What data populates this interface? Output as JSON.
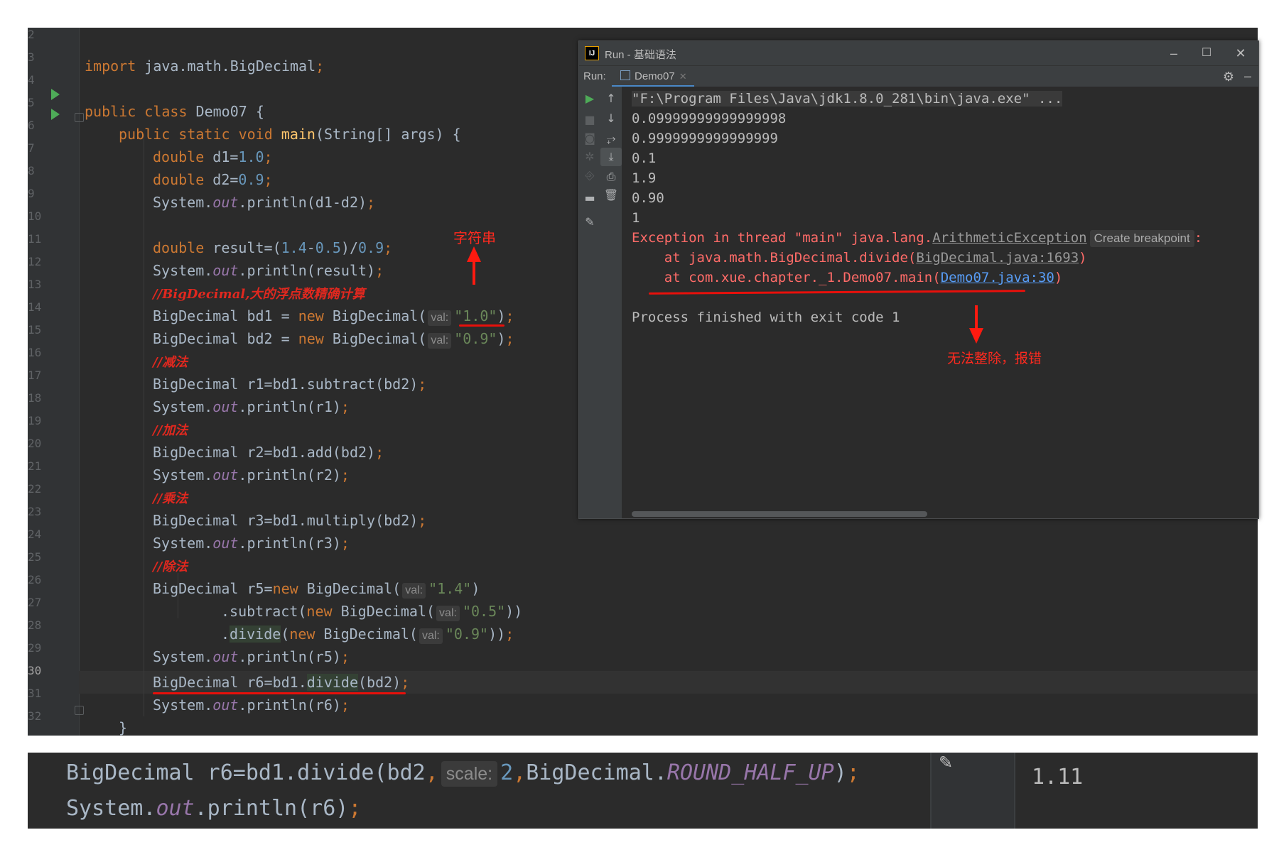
{
  "editor": {
    "line_numbers": [
      "2",
      "3",
      "4",
      "5",
      "6",
      "7",
      "8",
      "9",
      "10",
      "11",
      "12",
      "13",
      "14",
      "15",
      "16",
      "17",
      "18",
      "19",
      "20",
      "21",
      "22",
      "23",
      "24",
      "25",
      "26",
      "27",
      "28",
      "29",
      "30",
      "31",
      "32"
    ],
    "lines": {
      "l3": {
        "kw": "import",
        "rest": " java.math.BigDecimal",
        "semi": ";"
      },
      "l5": {
        "kw": "public class",
        "rest": " Demo07 {"
      },
      "l6": {
        "kw": "public static void",
        "fn": "main",
        "rest": "(String[] args) {"
      },
      "l7": {
        "kw": "double",
        "a": " d1=",
        "num": "1.0",
        "semi": ";"
      },
      "l8": {
        "kw": "double",
        "a": " d2=",
        "num": "0.9",
        "semi": ";"
      },
      "l9": {
        "a": "System.",
        "it": "out",
        "b": ".println(d1-d2)",
        "semi": ";"
      },
      "l11": {
        "kw": "double",
        "a": " result=(",
        "n1": "1.4",
        "b": "-",
        "n2": "0.5",
        "c": ")/",
        "n3": "0.9",
        "semi": ";"
      },
      "l12": {
        "a": "System.",
        "it": "out",
        "b": ".println(result)",
        "semi": ";"
      },
      "l13": {
        "cmt": "//BigDecimal,大的浮点数精确计算"
      },
      "l14": {
        "a": "BigDecimal bd1 = ",
        "kw": "new",
        "b": " BigDecimal(",
        "hint": "val:",
        "str": "\"1.0\"",
        "c": ")",
        "semi": ";"
      },
      "l15": {
        "a": "BigDecimal bd2 = ",
        "kw": "new",
        "b": " BigDecimal(",
        "hint": "val:",
        "str": "\"0.9\"",
        "c": ")",
        "semi": ";"
      },
      "l16": {
        "cmt": "//减法"
      },
      "l17": {
        "a": "BigDecimal r1=bd1.subtract(bd2)",
        "semi": ";"
      },
      "l18": {
        "a": "System.",
        "it": "out",
        "b": ".println(r1)",
        "semi": ";"
      },
      "l19": {
        "cmt": "//加法"
      },
      "l20": {
        "a": "BigDecimal r2=bd1.add(bd2)",
        "semi": ";"
      },
      "l21": {
        "a": "System.",
        "it": "out",
        "b": ".println(r2)",
        "semi": ";"
      },
      "l22": {
        "cmt": "//乘法"
      },
      "l23": {
        "a": "BigDecimal r3=bd1.multiply(bd2)",
        "semi": ";"
      },
      "l24": {
        "a": "System.",
        "it": "out",
        "b": ".println(r3)",
        "semi": ";"
      },
      "l25": {
        "cmt": "//除法"
      },
      "l26": {
        "a": "BigDecimal r5=",
        "kw": "new",
        "b": " BigDecimal(",
        "hint": "val:",
        "str": "\"1.4\"",
        "c": ")"
      },
      "l27": {
        "a": ".subtract(",
        "kw": "new",
        "b": " BigDecimal(",
        "hint": "val:",
        "str": "\"0.5\"",
        "c": "))"
      },
      "l28": {
        "a": ".",
        "div": "divide",
        "b": "(",
        "kw": "new",
        "c": " BigDecimal(",
        "hint": "val:",
        "str": "\"0.9\"",
        "d": "))",
        "semi": ";"
      },
      "l29": {
        "a": "System.",
        "it": "out",
        "b": ".println(r5)",
        "semi": ";"
      },
      "l30": {
        "a": "BigDecimal r6=bd1.",
        "div": "divide",
        "b": "(bd2)",
        "semi": ";"
      },
      "l31": {
        "a": "System.",
        "it": "out",
        "b": ".println(r6)",
        "semi": ";"
      },
      "l32": {
        "a": "}"
      }
    }
  },
  "annotations": {
    "string_note": "字符串",
    "error_note": "无法整除，报错"
  },
  "run_window": {
    "title": "Run - 基础语法",
    "run_label": "Run:",
    "tab_label": "Demo07",
    "console": {
      "cmd": "\"F:\\Program Files\\Java\\jdk1.8.0_281\\bin\\java.exe\" ...",
      "outputs": [
        "0.09999999999999998",
        "0.9999999999999999",
        "0.1",
        "1.9",
        "0.90",
        "1"
      ],
      "exception_prefix": "Exception in thread \"main\" java.lang.",
      "exception_class": "ArithmeticException",
      "create_breakpoint": "Create breakpoint",
      "exception_suffix": ":",
      "trace1_prefix": "    at java.math.BigDecimal.divide(",
      "trace1_link": "BigDecimal.java:1693",
      "trace1_suffix": ")",
      "trace2_prefix": "    at com.xue.chapter._1.Demo07.main(",
      "trace2_link": "Demo07.java:30",
      "trace2_suffix": ")",
      "finished": "Process finished with exit code 1"
    }
  },
  "strip": {
    "line1_a": "BigDecimal r6=bd1.divide(bd2",
    "line1_comma": ",",
    "line1_hint": "scale:",
    "line1_num": "2",
    "line1_comma2": ",",
    "line1_b": "BigDecimal.",
    "line1_const": "ROUND_HALF_UP",
    "line1_c": ")",
    "line1_semi": ";",
    "line2_a": "System.",
    "line2_it": "out",
    "line2_b": ".println(r6)",
    "line2_semi": ";",
    "result": "1.11"
  }
}
